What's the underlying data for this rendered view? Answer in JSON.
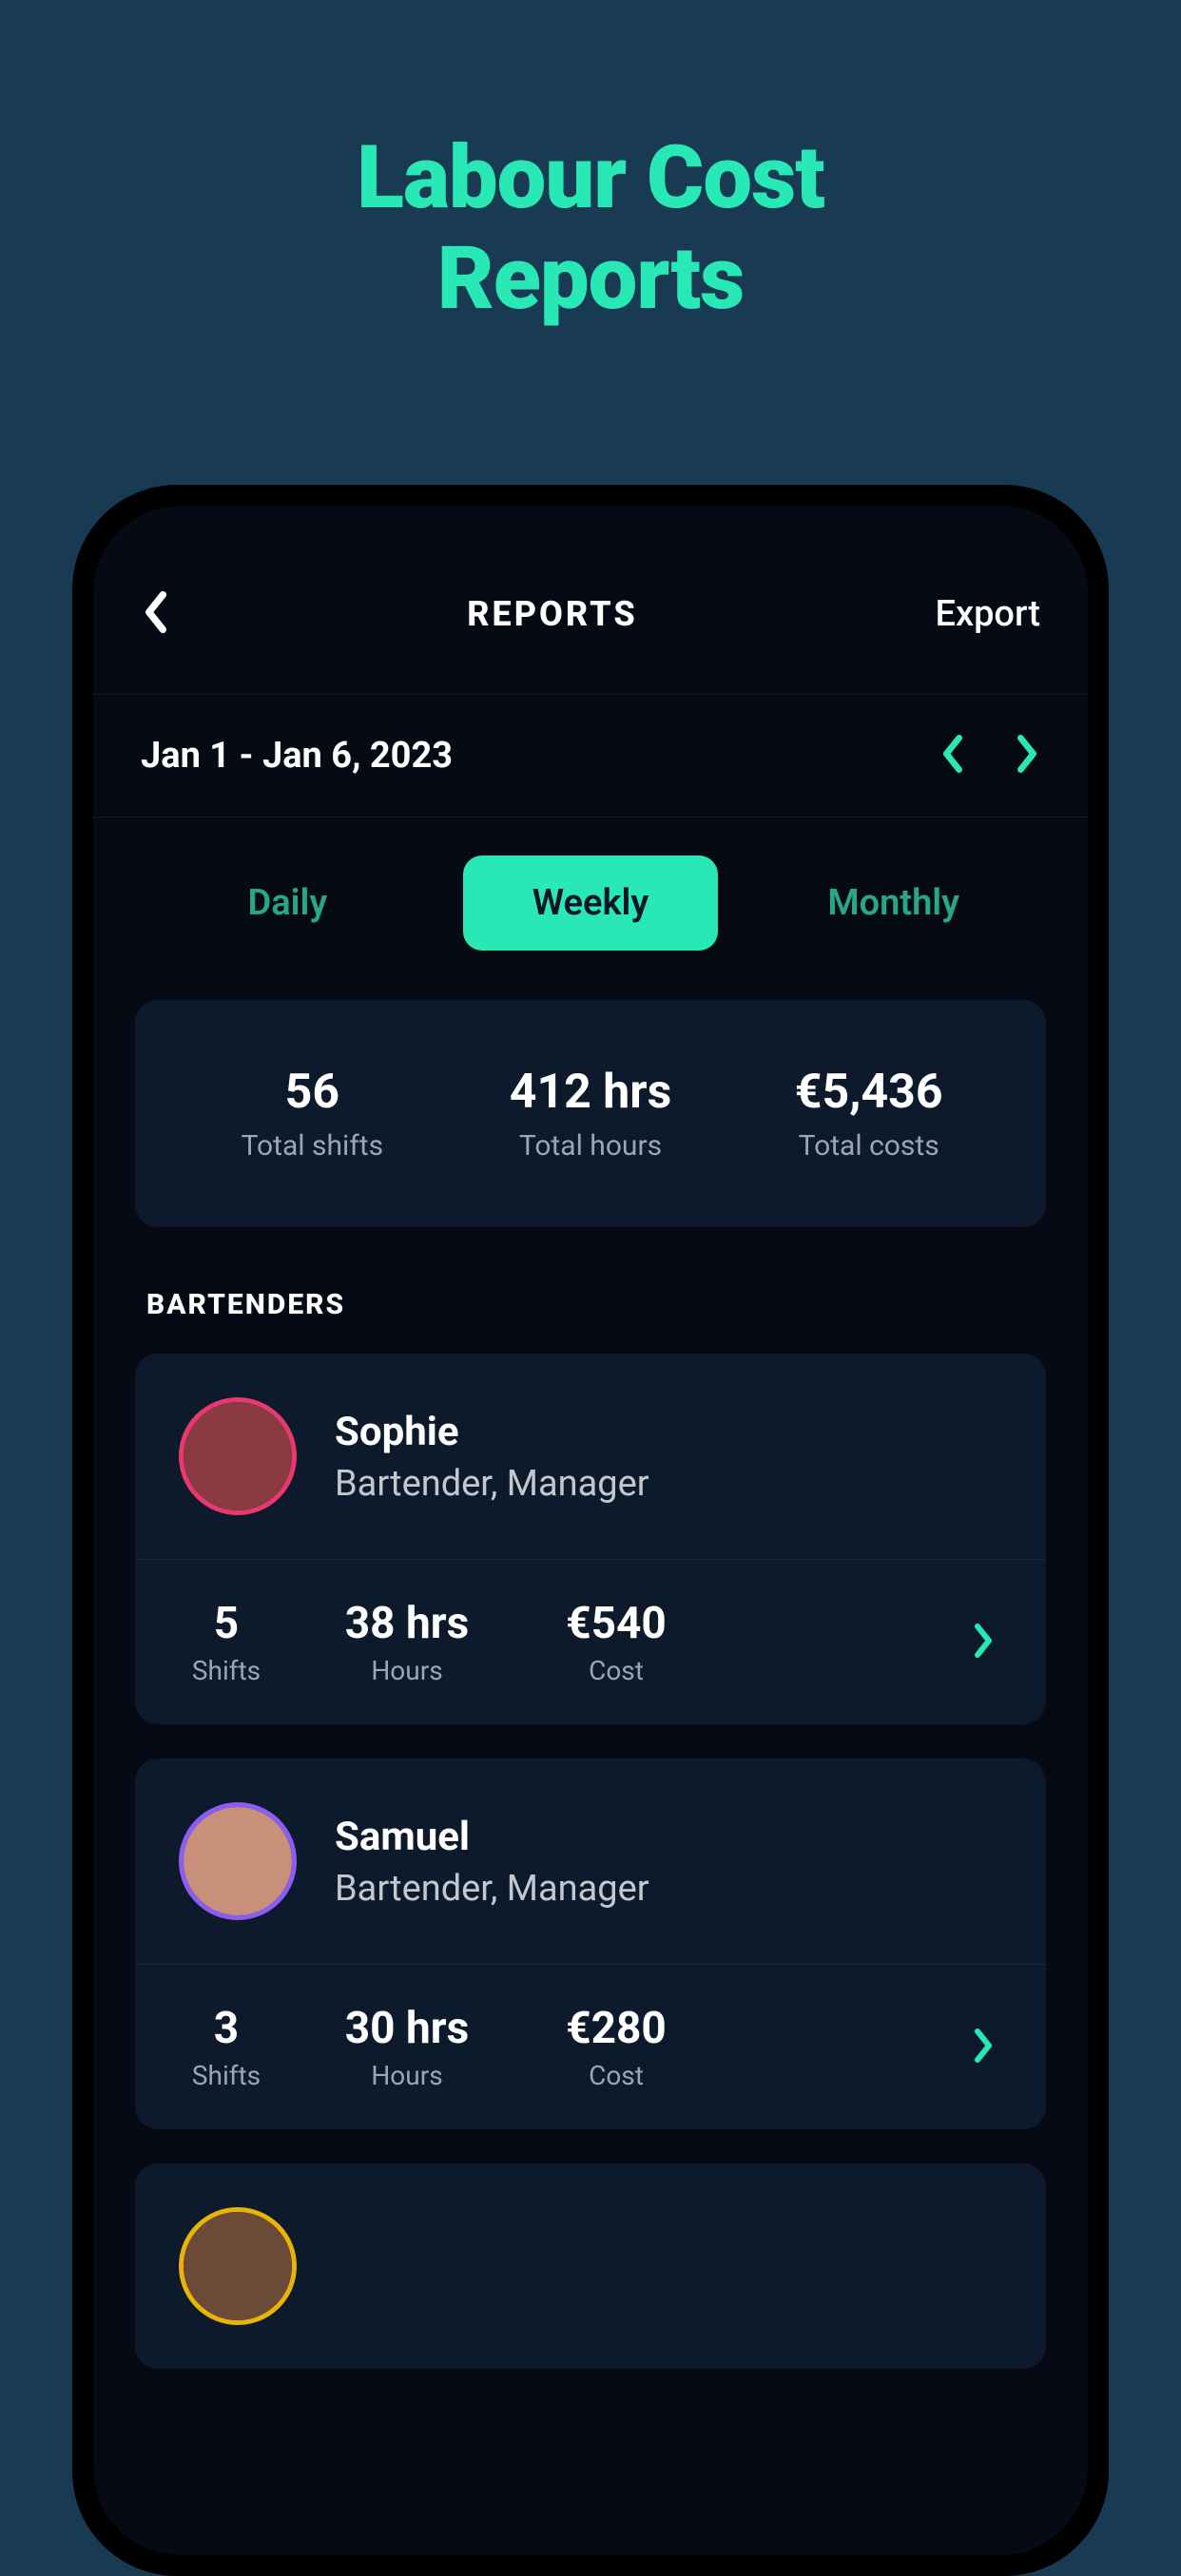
{
  "promo": {
    "title_line1": "Labour Cost",
    "title_line2": "Reports"
  },
  "header": {
    "title": "REPORTS",
    "export_label": "Export"
  },
  "date_range": "Jan 1 - Jan 6, 2023",
  "tabs": [
    {
      "label": "Daily",
      "active": false
    },
    {
      "label": "Weekly",
      "active": true
    },
    {
      "label": "Monthly",
      "active": false
    }
  ],
  "summary": {
    "shifts": {
      "value": "56",
      "label": "Total shifts"
    },
    "hours": {
      "value": "412 hrs",
      "label": "Total hours"
    },
    "costs": {
      "value": "€5,436",
      "label": "Total costs"
    }
  },
  "section_title": "BARTENDERS",
  "employees": [
    {
      "name": "Sophie",
      "role": "Bartender, Manager",
      "ring_color": "#e8396e",
      "avatar_bg": "#8b3a42",
      "shifts": {
        "value": "5",
        "label": "Shifts"
      },
      "hours": {
        "value": "38 hrs",
        "label": "Hours"
      },
      "cost": {
        "value": "€540",
        "label": "Cost"
      }
    },
    {
      "name": "Samuel",
      "role": "Bartender, Manager",
      "ring_color": "#8b5cf6",
      "avatar_bg": "#c89078",
      "shifts": {
        "value": "3",
        "label": "Shifts"
      },
      "hours": {
        "value": "30 hrs",
        "label": "Hours"
      },
      "cost": {
        "value": "€280",
        "label": "Cost"
      }
    },
    {
      "name": "",
      "role": "",
      "ring_color": "#eab308",
      "avatar_bg": "#6b4a38"
    }
  ]
}
